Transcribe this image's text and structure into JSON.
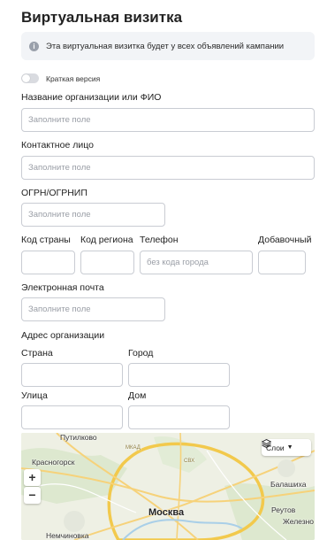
{
  "page_title": "Виртуальная визитка",
  "notice": {
    "icon": "info-icon",
    "text": "Эта виртуальная визитка будет у всех объявлений кампании"
  },
  "short_version": {
    "label": "Краткая версия",
    "enabled": false
  },
  "fields": {
    "org_name": {
      "label": "Название организации или ФИО",
      "placeholder": "Заполните поле",
      "value": ""
    },
    "contact": {
      "label": "Контактное лицо",
      "placeholder": "Заполните поле",
      "value": ""
    },
    "ogrn": {
      "label": "ОГРН/ОГРНИП",
      "placeholder": "Заполните поле",
      "value": ""
    },
    "country_code": {
      "label": "Код страны",
      "placeholder": "",
      "value": ""
    },
    "region_code": {
      "label": "Код региона",
      "placeholder": "",
      "value": ""
    },
    "phone": {
      "label": "Телефон",
      "placeholder": "без кода города",
      "value": ""
    },
    "extension": {
      "label": "Добавочный",
      "placeholder": "",
      "value": ""
    },
    "email": {
      "label": "Электронная почта",
      "placeholder": "Заполните поле",
      "value": ""
    }
  },
  "address": {
    "section_label": "Адрес организации",
    "country": {
      "label": "Страна",
      "value": ""
    },
    "city": {
      "label": "Город",
      "value": ""
    },
    "street": {
      "label": "Улица",
      "value": ""
    },
    "house": {
      "label": "Дом",
      "value": ""
    }
  },
  "map": {
    "layers_label": "Слои",
    "zoom_in": "+",
    "zoom_out": "−",
    "places": {
      "putilkovo": "Путилково",
      "krasnogorsk": "Красногорск",
      "moscow": "Москва",
      "balashikha": "Балашиха",
      "reutov": "Реутов",
      "zheleznodorozhny": "Железно",
      "nemchinovka": "Немчиновка",
      "mkad": "МКАД",
      "svkh": "СВХ"
    }
  }
}
